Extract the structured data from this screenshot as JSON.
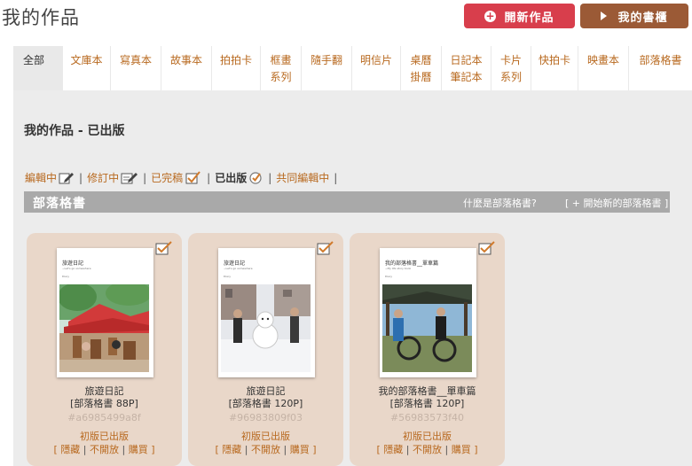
{
  "header": {
    "title": "我的作品",
    "new_button": "開新作品",
    "shelf_button": "我的書櫃"
  },
  "tabs": [
    {
      "line1": "全部",
      "line2": ""
    },
    {
      "line1": "文庫本",
      "line2": ""
    },
    {
      "line1": "寫真本",
      "line2": ""
    },
    {
      "line1": "故事本",
      "line2": ""
    },
    {
      "line1": "拍拍卡",
      "line2": ""
    },
    {
      "line1": "框畫",
      "line2": "系列"
    },
    {
      "line1": "隨手翻",
      "line2": ""
    },
    {
      "line1": "明信片",
      "line2": ""
    },
    {
      "line1": "桌曆",
      "line2": "掛曆"
    },
    {
      "line1": "日記本",
      "line2": "筆記本"
    },
    {
      "line1": "卡片",
      "line2": "系列"
    },
    {
      "line1": "快拍卡",
      "line2": ""
    },
    {
      "line1": "映畫本",
      "line2": ""
    },
    {
      "line1": "部落格書",
      "line2": ""
    }
  ],
  "section_title": "我的作品 - 已出版",
  "filters": {
    "editing": "編輯中",
    "revising": "修訂中",
    "completed": "已完稿",
    "published": "已出版",
    "co_editing": "共同編輯中",
    "sep": "|"
  },
  "category_bar": {
    "title": "部落格書",
    "what_is": "什麼是部落格書?",
    "start_new": "[ + 開始新的部落格書 ]"
  },
  "cards": [
    {
      "cover_title": "旅遊日記",
      "cover_subtitle": "~Let's go somewhere",
      "cover_label": "Diary",
      "name_line1": "旅遊日記",
      "name_line2": "[部落格書 88P]",
      "hash": "#a6985499a8f",
      "status": "初版已出版",
      "hide": "[ 隱藏",
      "private": "不開放",
      "buy": "購買 ]",
      "sep": " | "
    },
    {
      "cover_title": "旅遊日記",
      "cover_subtitle": "~Let's go somewhere",
      "cover_label": "Diary",
      "name_line1": "旅遊日記",
      "name_line2": "[部落格書 120P]",
      "hash": "#96983809f03",
      "status": "初版已出版",
      "hide": "[ 隱藏",
      "private": "不開放",
      "buy": "購買 ]",
      "sep": " | "
    },
    {
      "cover_title": "我的部落格書__單車篇",
      "cover_subtitle": "~My life story book",
      "cover_label": "Diary",
      "name_line1": "我的部落格書__單車篇",
      "name_line2": "[部落格書 120P]",
      "hash": "#56983573f40",
      "status": "初版已出版",
      "hide": "[ 隱藏",
      "private": "不開放",
      "buy": "購買 ]",
      "sep": " | "
    }
  ],
  "colors": {
    "accent_red": "#d83e4c",
    "accent_brown": "#9b5a36",
    "link_orange": "#b8691f",
    "card_bg": "#e9d7c9"
  }
}
